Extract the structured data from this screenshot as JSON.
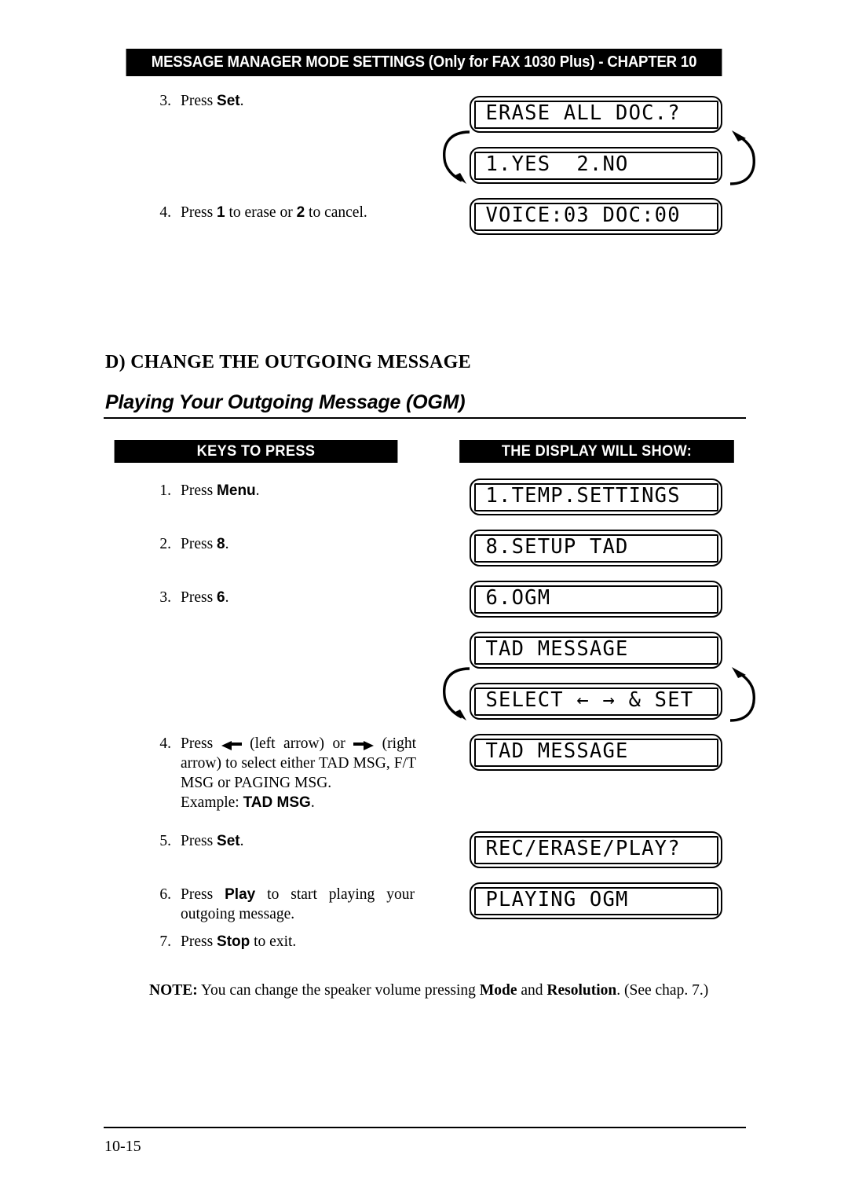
{
  "header": {
    "banner": "MESSAGE MANAGER MODE SETTINGS (Only for FAX 1030 Plus) - CHAPTER 10"
  },
  "top_section": {
    "steps": [
      {
        "number": "3.",
        "text_before": "Press ",
        "key": "Set",
        "text_after": "."
      },
      {
        "number": "4.",
        "text": "Press 1 to erase or 2 to cancel."
      }
    ],
    "displays": [
      {
        "text": "ERASE ALL DOC.?"
      },
      {
        "text": "1.YES  2.NO"
      },
      {
        "text": "VOICE:03 DOC:00"
      }
    ]
  },
  "section": {
    "heading": "D) CHANGE THE OUTGOING MESSAGE",
    "subheading": "Playing Your Outgoing Message (OGM)"
  },
  "columns": {
    "keys_header": "KEYS TO PRESS",
    "display_header": "THE DISPLAY WILL SHOW:"
  },
  "ogm_steps": {
    "s1_num": "1.",
    "s1_pre": "Press ",
    "s1_key": "Menu",
    "s1_post": ".",
    "s2_num": "2.",
    "s2_pre": "Press ",
    "s2_key": "8",
    "s2_post": ".",
    "s3_num": "3.",
    "s3_pre": "Press ",
    "s3_key": "6",
    "s3_post": ".",
    "s4_num": "4.",
    "s4_p1": "Press ",
    "s4_p2": " (left arrow) or ",
    "s4_p3": " (right arrow) to select either TAD MSG, F/T MSG or PAGING MSG.",
    "s4_p4": "Example: ",
    "s4_key": "TAD MSG",
    "s4_p5": ".",
    "s5_num": "5.",
    "s5_pre": "Press ",
    "s5_key": "Set",
    "s5_post": ".",
    "s6_num": "6.",
    "s6_pre": "Press ",
    "s6_key": "Play",
    "s6_post": " to start playing your outgoing message.",
    "s7_num": "7.",
    "s7_pre": "Press ",
    "s7_key": "Stop",
    "s7_post": " to exit."
  },
  "ogm_displays": [
    {
      "text": "1.TEMP.SETTINGS"
    },
    {
      "text": "8.SETUP TAD"
    },
    {
      "text": "6.OGM"
    },
    {
      "text": "TAD MESSAGE"
    },
    {
      "text": "SELECT ← → & SET"
    },
    {
      "text": "TAD MESSAGE"
    },
    {
      "text": "REC/ERASE/PLAY?"
    },
    {
      "text": "PLAYING OGM"
    }
  ],
  "note": {
    "label": "NOTE:",
    "p1": " You can change the speaker volume pressing ",
    "k1": "Mode",
    "p2": " and ",
    "k2": "Resolution",
    "p3": ". (See chap. 7.)"
  },
  "footer": {
    "page_number": "10-15"
  },
  "icons": {
    "loop_arrow_left": "loop-arrow-left-icon",
    "loop_arrow_right": "loop-arrow-right-icon",
    "left_triangle": "left-arrow-key-icon",
    "right_triangle": "right-arrow-key-icon"
  }
}
